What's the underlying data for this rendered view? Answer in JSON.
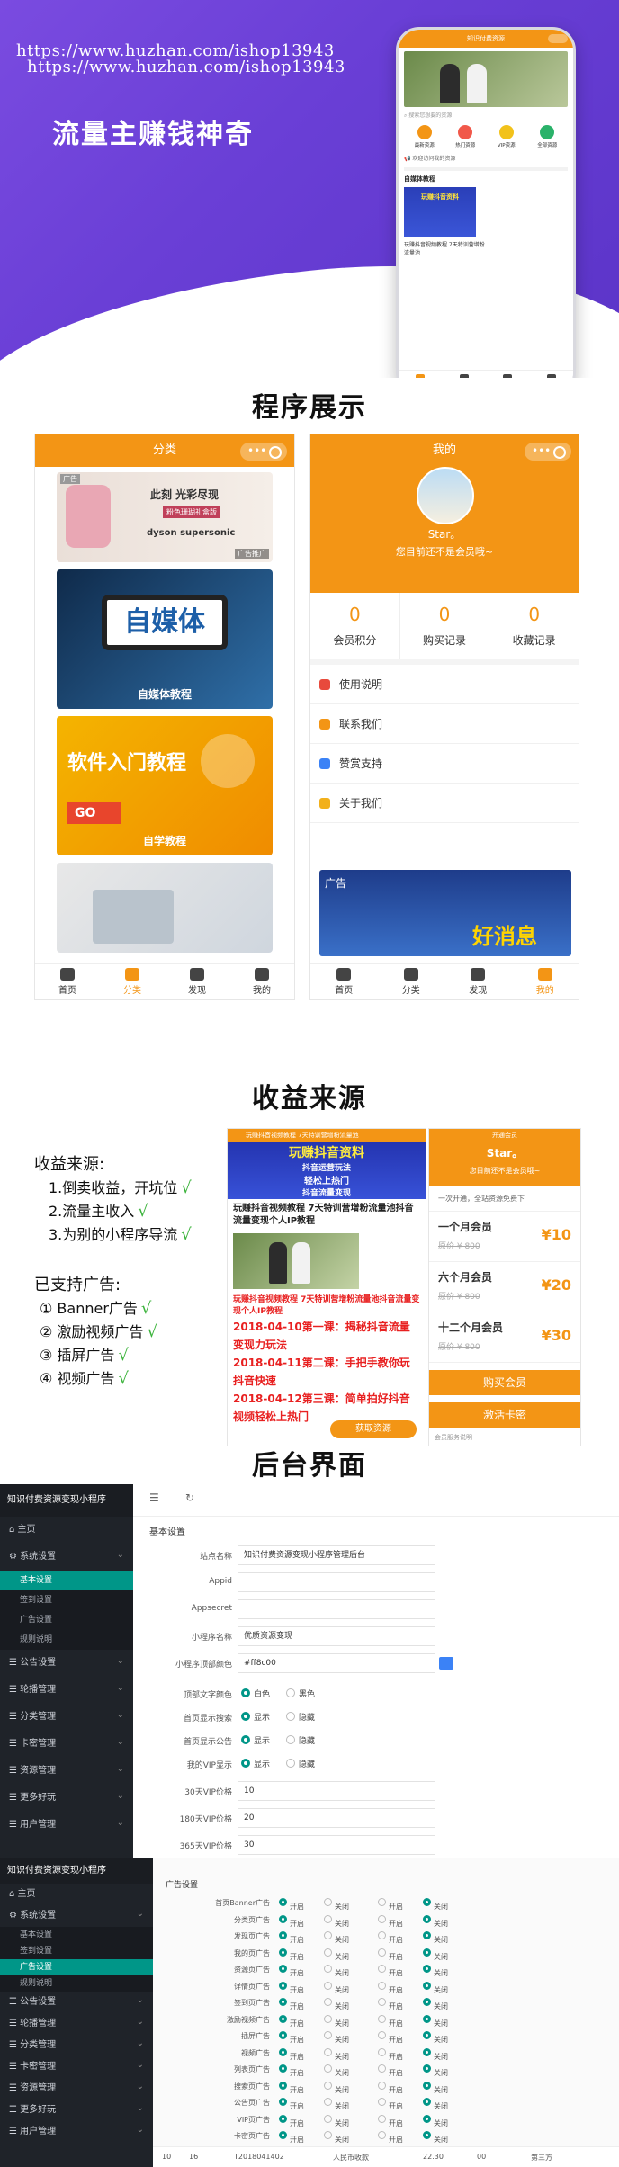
{
  "hero": {
    "url_line_1": "https://www.huzhan.com/ishop13943",
    "url_line_2": "https://www.huzhan.com/ishop13943",
    "headline": "流量主赚钱神奇"
  },
  "hero_phone": {
    "bar_title": "知识付费资源",
    "search_placeholder": "搜索您想要的资源",
    "icons": [
      {
        "label": "最新资源",
        "color": "#f39515"
      },
      {
        "label": "热门资源",
        "color": "#f1584a"
      },
      {
        "label": "VIP资源",
        "color": "#f2c21b"
      },
      {
        "label": "全部资源",
        "color": "#2ab26a"
      }
    ],
    "notice": "欢迎访问我的资源",
    "section": "自媒体教程",
    "card_title": "玩赚抖音资料",
    "card_caption": "玩赚抖音视频教程 7天特训营增粉流量池",
    "tabs": [
      "首页",
      "分类",
      "发现",
      "我的"
    ]
  },
  "sections": {
    "showcase": "程序展示",
    "revenue": "收益来源",
    "admin": "后台界面"
  },
  "category_screen": {
    "header": "分类",
    "tiles": [
      {
        "label": "",
        "text": "此刻 光彩尽现",
        "sub": "粉色珊瑚礼盒版",
        "brand": "dyson supersonic",
        "ad": "广告",
        "ad_tag": "广告推广"
      },
      {
        "label": "自媒体教程",
        "text": "自媒体"
      },
      {
        "label": "自学教程",
        "text": "软件入门教程",
        "go": "GO"
      },
      {
        "label": "",
        "text": ""
      }
    ],
    "tabs": [
      "首页",
      "分类",
      "发现",
      "我的"
    ]
  },
  "me_screen": {
    "header": "我的",
    "name": "Star。",
    "tip": "您目前还不是会员哦~",
    "stats": [
      {
        "value": "0",
        "label": "会员积分"
      },
      {
        "value": "0",
        "label": "购买记录"
      },
      {
        "value": "0",
        "label": "收藏记录"
      }
    ],
    "menu": [
      {
        "label": "使用说明",
        "color": "#e84a3c"
      },
      {
        "label": "联系我们",
        "color": "#f39515"
      },
      {
        "label": "赞赏支持",
        "color": "#3b82f6"
      },
      {
        "label": "关于我们",
        "color": "#f2b01b"
      }
    ],
    "game_banner": "广告",
    "game_text": "好消息",
    "tabs": [
      "首页",
      "分类",
      "发现",
      "我的"
    ]
  },
  "revenue": {
    "heading": "收益来源:",
    "items": [
      "1.倒卖收益，开坑位",
      "2.流量主收入",
      "3.为别的小程序导流"
    ],
    "ads_heading": "已支持广告:",
    "ads": [
      "① Banner广告",
      "② 激励视频广告",
      "③ 插屏广告",
      "④ 视频广告"
    ],
    "check": "√"
  },
  "article_screen": {
    "top_bar": "玩赚抖音视频教程 7天特训营增粉流量池",
    "banner_lines": [
      "玩赚抖音资料",
      "抖音运营玩法",
      "轻松上热门",
      "抖音流量变现"
    ],
    "title": "玩赚抖音视频教程 7天特训营增粉流量池抖音流量变现个人IP教程",
    "red_lines": [
      "玩赚抖音视频教程 7天特训营增粉流量池抖音流量变现个人IP教程",
      "2018-04-10第一课：揭秘抖音流量变现力玩法",
      "2018-04-11第二课：手把手教你玩抖音快速",
      "2018-04-12第三课：简单拍好抖音视频轻松上热门"
    ],
    "button": "获取资源"
  },
  "vip_screen": {
    "header": "开通会员",
    "name": "Star。",
    "tip": "您目前还不是会员哦~",
    "desc": "一次开通，全站资源免费下",
    "plans": [
      {
        "name": "一个月会员",
        "old": "原价 ¥ 800",
        "price": "¥10"
      },
      {
        "name": "六个月会员",
        "old": "原价 ¥ 800",
        "price": "¥20"
      },
      {
        "name": "十二个月会员",
        "old": "原价 ¥ 800",
        "price": "¥30"
      }
    ],
    "buy": "购买会员",
    "activate": "激活卡密",
    "note": "会员服务说明"
  },
  "admin": {
    "brand": "知识付费资源变现小程序",
    "nav": [
      "主页",
      "系统设置",
      "公告设置",
      "轮播管理",
      "分类管理",
      "卡密管理",
      "资源管理",
      "更多好玩",
      "用户管理"
    ],
    "sub_nav": [
      "基本设置",
      "签到设置",
      "广告设置",
      "规则说明"
    ],
    "form_title": "基本设置",
    "fields": [
      {
        "label": "站点名称",
        "value": "知识付费资源变现小程序管理后台"
      },
      {
        "label": "Appid",
        "value": ""
      },
      {
        "label": "Appsecret",
        "value": ""
      },
      {
        "label": "小程序名称",
        "value": "优质资源变现"
      },
      {
        "label": "小程序顶部颜色",
        "value": "#ff8c00"
      }
    ],
    "radios": [
      {
        "label": "顶部文字颜色",
        "a": "白色",
        "b": "黑色"
      },
      {
        "label": "首页显示搜索",
        "a": "显示",
        "b": "隐藏"
      },
      {
        "label": "首页显示公告",
        "a": "显示",
        "b": "隐藏"
      },
      {
        "label": "我的VIP显示",
        "a": "显示",
        "b": "隐藏"
      }
    ],
    "prices": [
      {
        "label": "30天VIP价格",
        "value": "10"
      },
      {
        "label": "180天VIP价格",
        "value": "20"
      },
      {
        "label": "365天VIP价格",
        "value": "30"
      }
    ]
  },
  "admin2": {
    "brand": "知识付费资源变现小程序",
    "nav": [
      "主页",
      "系统设置",
      "公告设置",
      "轮播管理",
      "分类管理",
      "卡密管理",
      "资源管理",
      "更多好玩",
      "用户管理"
    ],
    "sub_nav": [
      "基本设置",
      "签到设置",
      "广告设置",
      "规则说明"
    ],
    "form_title": "广告设置",
    "ad_rows": [
      "首页Banner广告",
      "分类页广告",
      "发现页广告",
      "我的页广告",
      "资源页广告",
      "详情页广告",
      "签到页广告",
      "激励视频广告",
      "插屏广告",
      "视频广告",
      "列表页广告",
      "搜索页广告",
      "公告页广告",
      "VIP页广告",
      "卡密页广告"
    ],
    "on_label": "开启",
    "off_label": "关闭",
    "footer_row": [
      "10",
      "16",
      "T2018041402",
      "人民币收款",
      "22.30",
      "00",
      "第三方"
    ]
  }
}
